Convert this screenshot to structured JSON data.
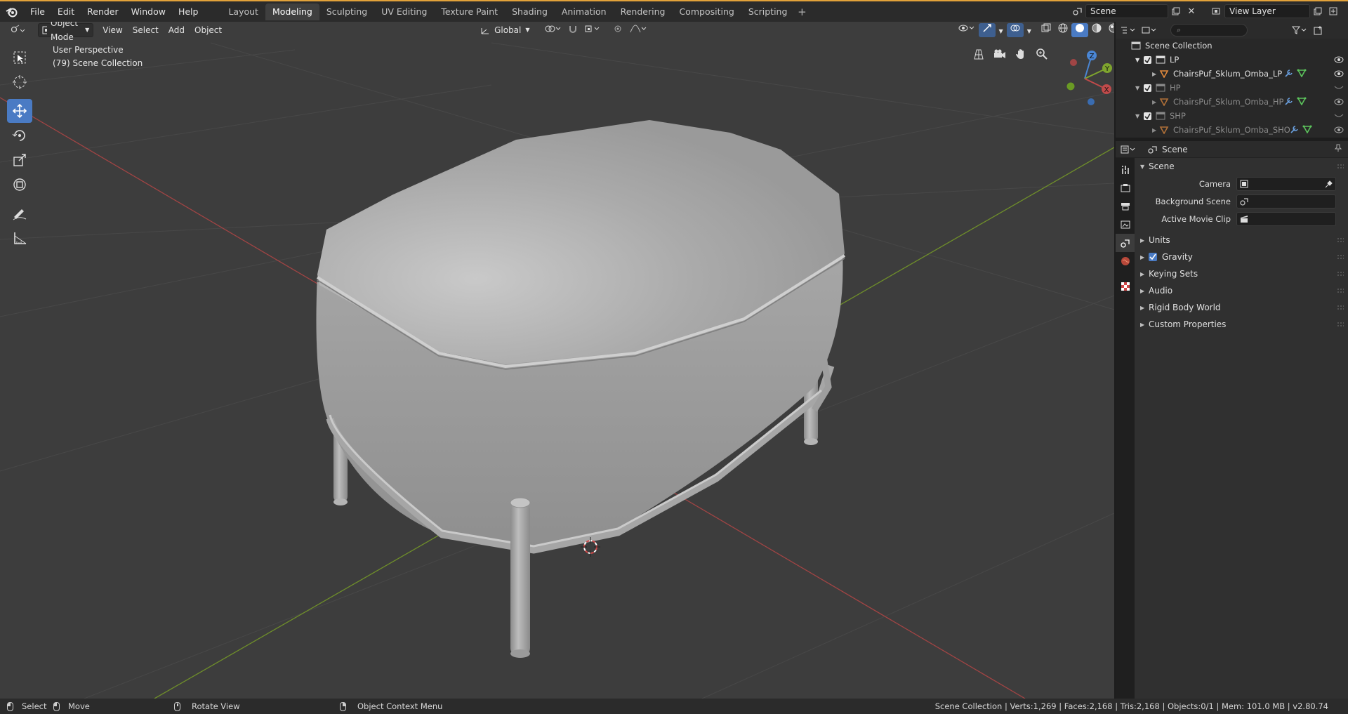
{
  "menubar": {
    "items": [
      "File",
      "Edit",
      "Render",
      "Window",
      "Help"
    ]
  },
  "workspaces": {
    "tabs": [
      "Layout",
      "Modeling",
      "Sculpting",
      "UV Editing",
      "Texture Paint",
      "Shading",
      "Animation",
      "Rendering",
      "Compositing",
      "Scripting"
    ],
    "active": "Modeling"
  },
  "scene_selector": {
    "scene": "Scene",
    "view_layer": "View Layer"
  },
  "viewport": {
    "mode": "Object Mode",
    "menus": [
      "View",
      "Select",
      "Add",
      "Object"
    ],
    "orientation": "Global",
    "perspective_label": "User Perspective",
    "collection_label": "(79) Scene Collection",
    "gizmo": {
      "x": "X",
      "y": "Y",
      "z": "Z"
    },
    "colors": {
      "x_axis": "#c04a4a",
      "y_axis": "#7fa52e",
      "bg": "#3d3d3d",
      "accent": "#4a7bc4"
    }
  },
  "outliner": {
    "root": "Scene Collection",
    "collections": [
      {
        "name": "LP",
        "object": "ChairsPuf_Sklum_Omba_LP",
        "visible": true
      },
      {
        "name": "HP",
        "object": "ChairsPuf_Sklum_Omba_HP",
        "visible": false
      },
      {
        "name": "SHP",
        "object": "ChairsPuf_Sklum_Omba_SHO",
        "visible": false
      }
    ]
  },
  "properties": {
    "header": "Scene",
    "panel_title": "Scene",
    "camera_label": "Camera",
    "background_scene_label": "Background Scene",
    "movie_clip_label": "Active Movie Clip",
    "subpanels": {
      "units": "Units",
      "gravity": "Gravity",
      "keying_sets": "Keying Sets",
      "audio": "Audio",
      "rigid_body": "Rigid Body World",
      "custom_props": "Custom Properties"
    },
    "gravity_checked": true
  },
  "statusbar": {
    "select": "Select",
    "move": "Move",
    "rotate": "Rotate View",
    "context_menu": "Object Context Menu",
    "stats": "Scene Collection | Verts:1,269 | Faces:2,168 | Tris:2,168 | Objects:0/1 | Mem: 101.0 MB | v2.80.74"
  }
}
